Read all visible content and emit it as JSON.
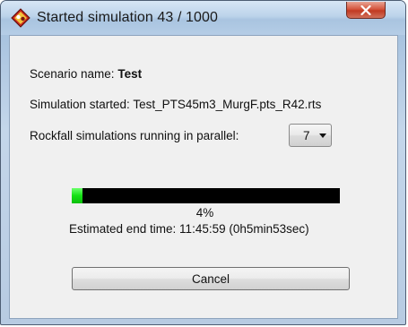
{
  "window": {
    "title": "Started simulation 43 / 1000"
  },
  "scenario": {
    "label": "Scenario name:",
    "value": "Test"
  },
  "simulation": {
    "label": "Simulation started:",
    "value": "Test_PTS45m3_MurgF.pts_R42.rts"
  },
  "parallel": {
    "label": "Rockfall simulations running in parallel:",
    "selected": "7"
  },
  "progress": {
    "fraction": 0.04,
    "percent_text": "4%"
  },
  "end_time": {
    "text": "Estimated end time: 11:45:59 (0h5min53sec)"
  },
  "buttons": {
    "cancel_label": "Cancel"
  },
  "icons": {
    "app": "app-logo-icon",
    "close": "close-icon",
    "dropdown": "chevron-down-icon"
  },
  "colors": {
    "progress_fill": "#14e014",
    "progress_track": "#000000",
    "close_button": "#c13a22"
  }
}
